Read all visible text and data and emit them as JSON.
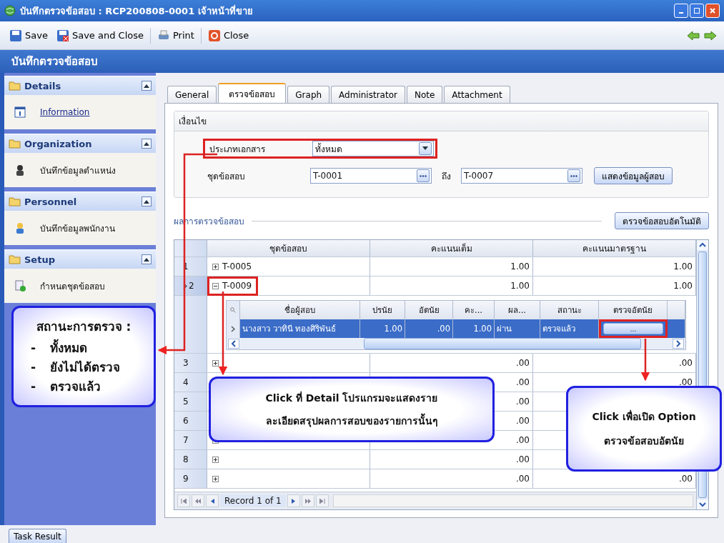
{
  "window": {
    "title": "บันทึกตรวจข้อสอบ : RCP200808-0001 เจ้าหน้าที่ขาย"
  },
  "toolbar": [
    {
      "label": "Save",
      "kind": "save"
    },
    {
      "label": "Save and Close",
      "kind": "save-close"
    },
    {
      "label": "Print",
      "kind": "print"
    },
    {
      "label": "Close",
      "kind": "close"
    }
  ],
  "header": {
    "title": "บันทึกตรวจข้อสอบ"
  },
  "sidebar": [
    {
      "title": "Details",
      "expanded": true,
      "items": [
        {
          "label": "Information",
          "kind": "info"
        }
      ]
    },
    {
      "title": "Organization",
      "expanded": true,
      "items": [
        {
          "label": "บันทึกข้อมูลตำแหน่ง",
          "kind": "person-dark"
        }
      ]
    },
    {
      "title": "Personnel",
      "expanded": true,
      "items": [
        {
          "label": "บันทึกข้อมูลพนักงาน",
          "kind": "person"
        }
      ]
    },
    {
      "title": "Setup",
      "expanded": true,
      "items": [
        {
          "label": "กำหนดชุดข้อสอบ",
          "kind": "doc-add"
        }
      ]
    }
  ],
  "tabs": [
    {
      "label": "General",
      "selected": false
    },
    {
      "label": "ตรวจข้อสอบ",
      "selected": true
    },
    {
      "label": "Graph",
      "selected": false
    },
    {
      "label": "Administrator",
      "selected": false
    },
    {
      "label": "Note",
      "selected": false
    },
    {
      "label": "Attachment",
      "selected": false
    }
  ],
  "conditions": {
    "title": "เงื่อนไข",
    "doc_type_label": "ประเภทเอกสาร",
    "doc_type_value": "ทั้งหมด",
    "doc_type_highlighted": true,
    "test_set_label": "ชุดข้อสอบ",
    "from_value": "T-0001",
    "to_label": "ถึง",
    "to_value": "T-0007",
    "show_button": "แสดงข้อมูลผู้สอบ"
  },
  "results": {
    "title": "ผลการตรวจข้อสอบ",
    "auto_button": "ตรวจข้อสอบอัตโนมัติ"
  },
  "grid": {
    "columns": [
      "ชุดข้อสอบ",
      "คะแนนเต็ม",
      "คะแนนมาตรฐาน"
    ],
    "rows": [
      {
        "number": "1",
        "test_set": "T-0005",
        "full": "1.00",
        "standard": "1.00",
        "expanded": false,
        "current": false,
        "highlighted": false
      },
      {
        "number": "2",
        "test_set": "T-0009",
        "full": "1.00",
        "standard": "1.00",
        "expanded": true,
        "current": true,
        "highlighted": true
      },
      {
        "number": "3",
        "test_set": "",
        "full": ".00",
        "standard": ".00",
        "expanded": false,
        "current": false,
        "highlighted": false
      },
      {
        "number": "4",
        "test_set": "",
        "full": ".00",
        "standard": ".00",
        "expanded": false,
        "current": false,
        "highlighted": false
      },
      {
        "number": "5",
        "test_set": "",
        "full": ".00",
        "expanded": false,
        "current": false,
        "highlighted": false
      },
      {
        "number": "6",
        "test_set": "",
        "full": ".00",
        "expanded": false,
        "current": false,
        "highlighted": false
      },
      {
        "number": "7",
        "test_set": "",
        "full": ".00",
        "expanded": false,
        "current": false,
        "highlighted": false
      },
      {
        "number": "8",
        "test_set": "",
        "full": ".00",
        "expanded": false,
        "current": false,
        "highlighted": false
      },
      {
        "number": "9",
        "test_set": "",
        "full": ".00",
        "standard": ".00",
        "expanded": false,
        "current": false,
        "highlighted": false
      }
    ],
    "detail": {
      "columns": [
        "ชื่อผู้สอบ",
        "ปรนัย",
        "อัตนัย",
        "คะ...",
        "ผล...",
        "สถานะ",
        "ตรวจอัตนัย"
      ],
      "rows": [
        {
          "name": "นางสาว วาทินี ทองศิริพันธ์",
          "objective": "1.00",
          "subjective": ".00",
          "score": "1.00",
          "result": "ผ่าน",
          "status": "ตรวจแล้ว",
          "button": "...",
          "selected": true,
          "button_highlighted": true
        }
      ]
    },
    "pager": "Record 1 of 1"
  },
  "callouts": [
    {
      "kind": "list",
      "title": "สถานะการตรวจ :",
      "marker": "-",
      "lines": [
        "ทั้งหมด",
        "ยังไม่ได้ตรวจ",
        "ตรวจแล้ว"
      ]
    },
    {
      "kind": "text",
      "lines": [
        "Click ที่ Detail โปรแกรมจะแสดงราย",
        "ละเอียดสรุปผลการสอบของรายการนั้นๆ"
      ]
    },
    {
      "kind": "text",
      "lines": [
        "Click เพื่อเปิด Option",
        "ตรวจข้อสอบอัตนัย"
      ]
    }
  ],
  "task_tab": "Task Result"
}
